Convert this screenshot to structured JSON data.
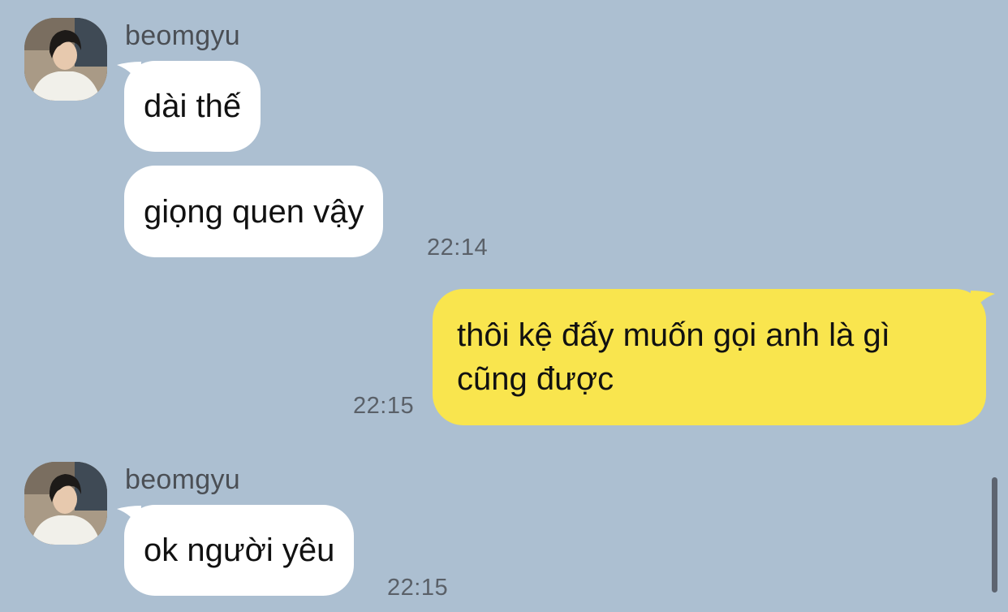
{
  "colors": {
    "background": "#acbfd1",
    "incoming_bubble": "#ffffff",
    "outgoing_bubble": "#f9e54e",
    "scrollbar": "#5d6470"
  },
  "messages": [
    {
      "sender": "beomgyu",
      "avatar_icon": "profile-photo-icon",
      "bubbles": [
        "dài thế",
        "giọng quen vậy"
      ],
      "time": "22:14"
    },
    {
      "outgoing": true,
      "text": "thôi kệ đấy muốn gọi anh là gì cũng được",
      "time": "22:15"
    },
    {
      "sender": "beomgyu",
      "avatar_icon": "profile-photo-icon",
      "bubbles": [
        "ok người yêu"
      ],
      "time": "22:15"
    }
  ]
}
